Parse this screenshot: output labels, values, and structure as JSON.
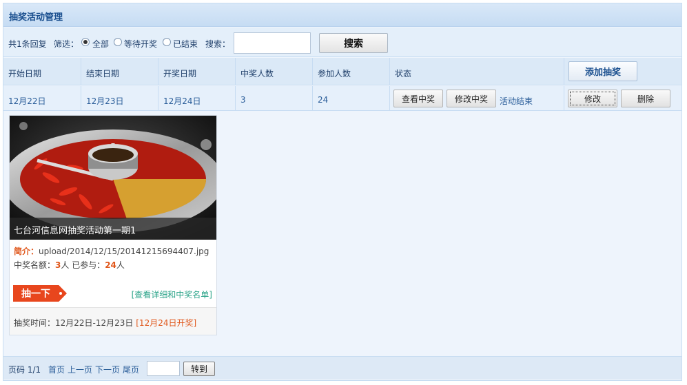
{
  "panel": {
    "title": "抽奖活动管理"
  },
  "filter": {
    "total": "共1条回复",
    "label": "筛选：",
    "options": [
      "全部",
      "等待开奖",
      "已结束"
    ],
    "selected": "全部",
    "search_label": "搜索：",
    "search_value": "",
    "search_button": "搜索"
  },
  "table": {
    "headers": [
      "开始日期",
      "结束日期",
      "开奖日期",
      "中奖人数",
      "参加人数",
      "状态"
    ],
    "add_button": "添加抽奖",
    "row": {
      "start": "12月22日",
      "end": "12月23日",
      "draw": "12月24日",
      "winners": "3",
      "participants": "24",
      "view_winners": "查看中奖",
      "edit_winners": "修改中奖",
      "status": "活动结束",
      "edit": "修改",
      "delete": "删除"
    }
  },
  "card": {
    "caption": "七台河信息网抽奖活动第一期1",
    "intro_label": "简介：",
    "intro_value": "upload/2014/12/15/20141215694407.jpg",
    "quota_label": "中奖名额：",
    "quota_value": "3",
    "quota_unit": "人 已参与：",
    "joined_value": "24",
    "joined_unit": "人",
    "draw_button": "抽一下",
    "detail_link": "[查看详细和中奖名单]",
    "time_label": "抽奖时间：12月22日-12月23日",
    "draw_date": "[12月24日开奖]"
  },
  "pager": {
    "page_info": "页码 1/1",
    "first": "首页",
    "prev": "上一页",
    "next": "下一页",
    "last": "尾页",
    "page_input": "",
    "goto_button": "转到"
  },
  "colors": {
    "accent": "#1a4f8f",
    "highlight": "#e0571b",
    "draw_button": "#e8461d",
    "link_green": "#2aa388"
  }
}
